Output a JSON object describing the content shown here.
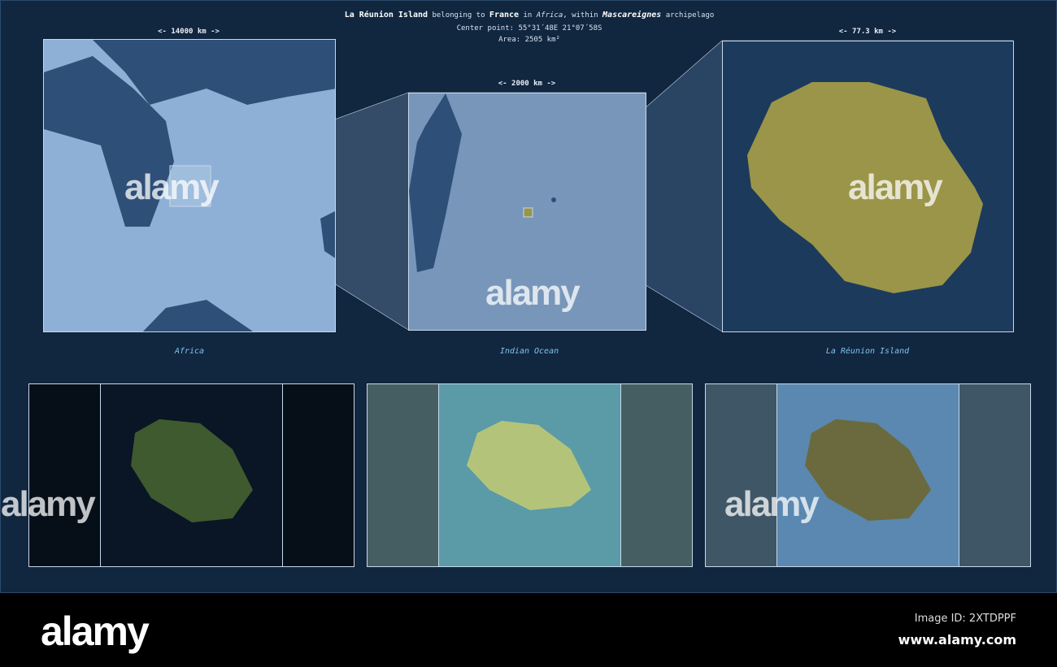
{
  "header": {
    "name": "La Réunion Island",
    "t1": "belonging to",
    "country": "France",
    "t2": "in",
    "continent": "Africa",
    "t3": ", within",
    "archipelago": "Mascareignes",
    "t4": "archipelago",
    "center": "Center point: 55°31´48E  21°07´58S",
    "area": "Area: 2505 km²"
  },
  "panels": [
    {
      "label": "Africa",
      "scale": "<-   14000 km   ->"
    },
    {
      "label": "Indian Ocean",
      "scale": "<-   2000 km   ->"
    },
    {
      "label": "La Réunion Island",
      "scale": "<-   77.3 km   ->"
    }
  ],
  "colors": {
    "background": "#11263f",
    "island": "#9a9548",
    "ocean_light": "#8fb0d6",
    "land_dark": "#2d4f78"
  },
  "watermark": "alamy",
  "footer": {
    "logo": "alamy",
    "image_id": "Image ID: 2XTDPPF",
    "url": "www.alamy.com"
  }
}
